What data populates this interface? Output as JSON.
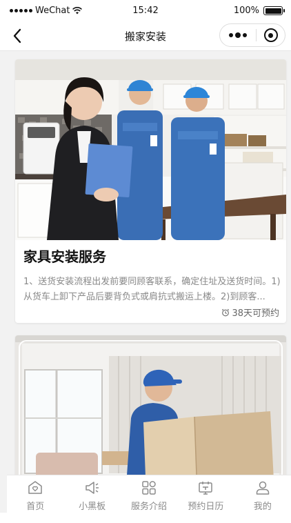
{
  "status_bar": {
    "carrier": "WeChat",
    "time": "15:42",
    "battery": "100%"
  },
  "nav": {
    "title": "搬家安装"
  },
  "cards": [
    {
      "title": "家具安装服务",
      "description": "1、送货安装流程出发前要同顾客联系，确定住址及送货时间。1)从货车上卸下产品后要背负式或肩抗式搬运上楼。2)到顾客...",
      "meta": "38天可预约",
      "image": "家具安装服务"
    },
    {
      "image": "搬家安装"
    }
  ],
  "tabbar": {
    "items": [
      {
        "label": "首页",
        "icon": "home-icon"
      },
      {
        "label": "小黑板",
        "icon": "megaphone-icon"
      },
      {
        "label": "服务介绍",
        "icon": "grid-icon"
      },
      {
        "label": "预约日历",
        "icon": "calendar-icon"
      },
      {
        "label": "我的",
        "icon": "user-icon"
      }
    ]
  },
  "colors": {
    "tab_inactive": "#8a8a8a",
    "card_title": "#111111",
    "card_text": "#888888"
  }
}
